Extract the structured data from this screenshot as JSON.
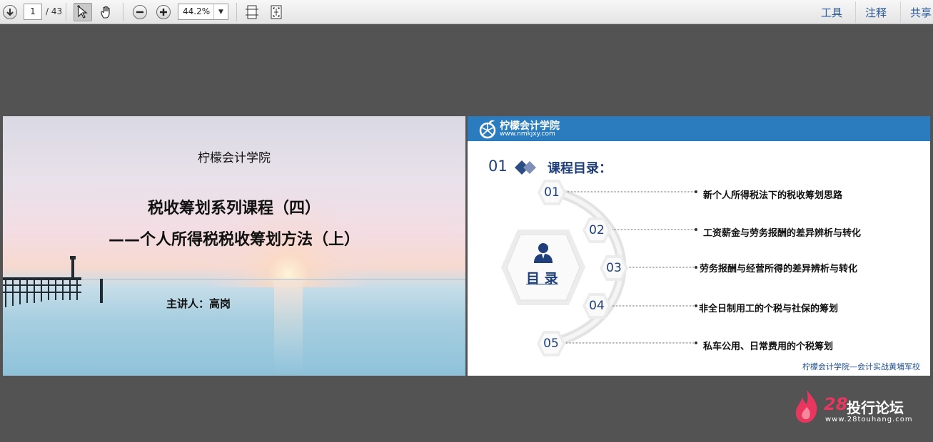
{
  "toolbar": {
    "page_current": "1",
    "page_total": "/ 43",
    "zoom": "44.2%",
    "links": [
      "工具",
      "注释",
      "共享"
    ],
    "icons": [
      "page-down-icon",
      "select-cursor-icon",
      "hand-tool-icon",
      "zoom-out-icon",
      "zoom-in-icon",
      "fit-width-icon",
      "fit-page-icon"
    ]
  },
  "slide1": {
    "org": "柠檬会计学院",
    "title_line1": "税收筹划系列课程（四）",
    "title_line2": "——个人所得税税收筹划方法（上）",
    "presenter": "主讲人：高岗"
  },
  "slide2": {
    "logo_title": "柠檬会计学院",
    "logo_sub": "www.nmkjxy.com",
    "section_num": "01",
    "section_title": "课程目录：",
    "center_label": "目 录",
    "items": [
      {
        "num": "01",
        "text": "新个人所得税法下的税收筹划思路"
      },
      {
        "num": "02",
        "text": "工资薪金与劳务报酬的差异辨析与转化"
      },
      {
        "num": "03",
        "text": "劳务报酬与经营所得的差异辨析与转化"
      },
      {
        "num": "04",
        "text": "非全日制用工的个税与社保的筹划"
      },
      {
        "num": "05",
        "text": "私车公用、日常费用的个税筹划"
      }
    ],
    "footer": "柠檬会计学院—会计实战黄埔军校"
  },
  "watermark": {
    "number": "28",
    "text": "投行论坛",
    "url": "www.28touhang.com"
  },
  "colors": {
    "accent_blue": "#2a7cbf",
    "dark_blue": "#1e3f7a",
    "background": "#535353"
  }
}
